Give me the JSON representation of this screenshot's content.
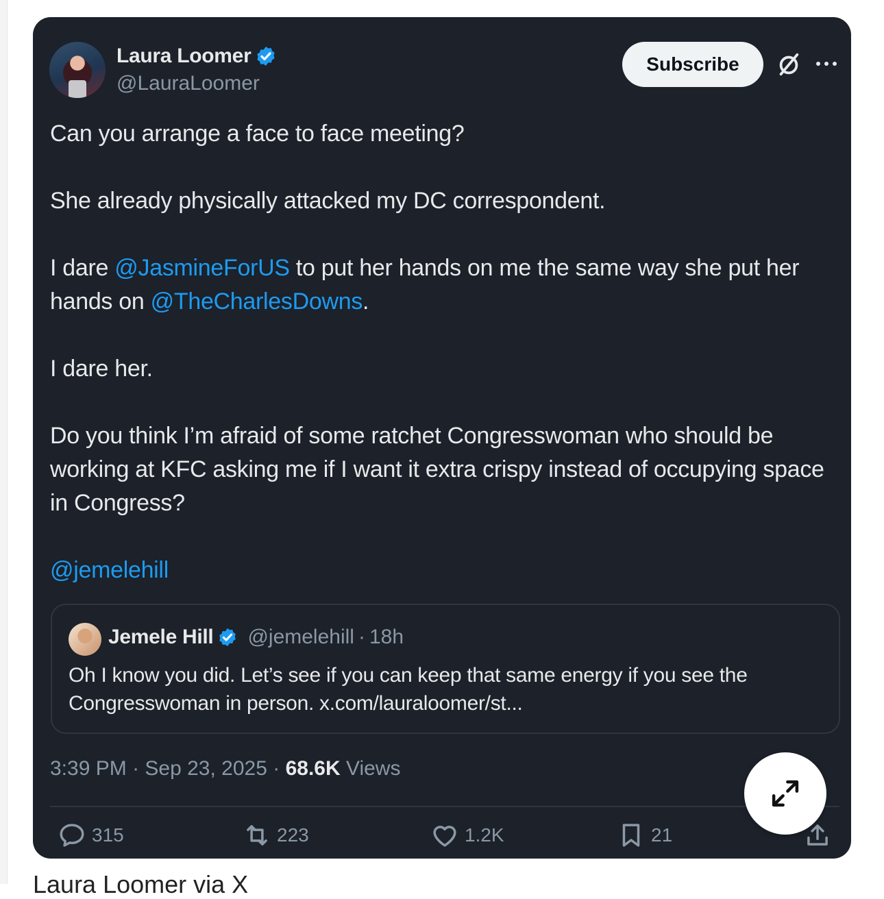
{
  "author": {
    "name": "Laura Loomer",
    "handle": "@LauraLoomer"
  },
  "subscribe_label": "Subscribe",
  "tweet": {
    "line1": "Can you arrange a face to face meeting?",
    "line2": "She already physically attacked my DC correspondent.",
    "line3_a": "I dare ",
    "mention1": "@JasmineForUS",
    "line3_b": " to put her hands on me the same way she put her hands on ",
    "mention2": "@TheCharlesDowns",
    "line3_c": ".",
    "line4": "I dare her.",
    "line5": "Do you think I’m afraid of some ratchet Congresswoman who should be working at KFC asking me if I want it extra crispy instead of occupying space in Congress?",
    "mention3": "@jemelehill"
  },
  "quote": {
    "name": "Jemele Hill",
    "handle": "@jemelehill",
    "separator": "·",
    "time": "18h",
    "text": "Oh I know you did. Let’s see if you can keep that same energy if you see the Congresswoman in person. x.com/lauraloomer/st..."
  },
  "meta": {
    "time": "3:39 PM",
    "date": "Sep 23, 2025",
    "views_count": "68.6K",
    "views_label": "Views"
  },
  "actions": {
    "replies": "315",
    "reposts": "223",
    "likes": "1.2K",
    "bookmarks": "21"
  },
  "caption": "Laura Loomer via X",
  "colors": {
    "card_bg": "#1c212a",
    "mention": "#1d9bf0",
    "verified": "#1d9bf0"
  }
}
